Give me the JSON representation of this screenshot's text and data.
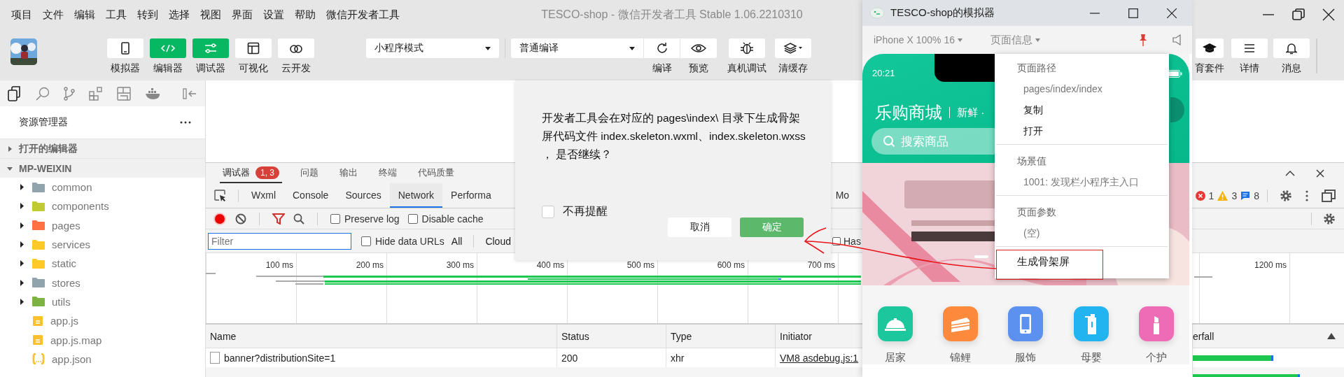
{
  "menu_bar": {
    "items": [
      "项目",
      "文件",
      "编辑",
      "工具",
      "转到",
      "选择",
      "视图",
      "界面",
      "设置",
      "帮助",
      "微信开发者工具"
    ]
  },
  "window": {
    "title": "TESCO-shop - 微信开发者工具 Stable 1.06.2210310"
  },
  "toolbar": {
    "view_buttons": [
      {
        "label": "模拟器",
        "on": false
      },
      {
        "label": "编辑器",
        "on": true
      },
      {
        "label": "调试器",
        "on": true
      },
      {
        "label": "可视化",
        "on": false
      },
      {
        "label": "云开发",
        "on": false
      }
    ],
    "mode_select": {
      "value": "小程序模式"
    },
    "compile_select": {
      "value": "普通编译"
    },
    "actions": [
      {
        "label": "编译"
      },
      {
        "label": "预览"
      },
      {
        "label": "真机调试"
      },
      {
        "label": "清缓存"
      }
    ],
    "right_buttons": [
      {
        "label": "育套件"
      },
      {
        "label": "详情"
      },
      {
        "label": "消息"
      }
    ]
  },
  "sidebar": {
    "title": "资源管理器",
    "sections": [
      {
        "label": "打开的编辑器",
        "expanded": false
      },
      {
        "label": "MP-WEIXIN",
        "expanded": true
      }
    ],
    "items": [
      {
        "name": "common",
        "kind": "folder",
        "color": "#90a4ae",
        "expanded": false
      },
      {
        "name": "components",
        "kind": "folder",
        "color": "#c0ca33",
        "expanded": false
      },
      {
        "name": "pages",
        "kind": "folder",
        "color": "#ff7043",
        "expanded": false
      },
      {
        "name": "services",
        "kind": "folder",
        "color": "#ffca28",
        "expanded": false
      },
      {
        "name": "static",
        "kind": "folder",
        "color": "#ffca28",
        "expanded": false
      },
      {
        "name": "stores",
        "kind": "folder",
        "color": "#90a4ae",
        "expanded": false
      },
      {
        "name": "utils",
        "kind": "folder",
        "color": "#7cb342",
        "expanded": false
      },
      {
        "name": "app.js",
        "kind": "js",
        "color": "#fbc02d"
      },
      {
        "name": "app.js.map",
        "kind": "js",
        "color": "#fbc02d"
      },
      {
        "name": "app.json",
        "kind": "json",
        "color": "#fbc02d"
      }
    ]
  },
  "debugger": {
    "tabs": [
      {
        "label": "调试器",
        "badge": "1, 3",
        "selected": true
      },
      {
        "label": "问题",
        "selected": false
      },
      {
        "label": "输出",
        "selected": false
      },
      {
        "label": "终端",
        "selected": false
      },
      {
        "label": "代码质量",
        "selected": false
      }
    ],
    "devtools_tabs": [
      {
        "label": "Wxml",
        "selected": false
      },
      {
        "label": "Console",
        "selected": false
      },
      {
        "label": "Sources",
        "selected": false
      },
      {
        "label": "Network",
        "selected": true
      },
      {
        "label": "Performa",
        "selected": false
      },
      {
        "label": "Mo",
        "selected": false
      }
    ],
    "counts": {
      "errors": "1",
      "warnings": "3",
      "messages": "8"
    },
    "network_toolbar": {
      "recording": true,
      "options": [
        {
          "label": "Preserve log",
          "checked": false
        },
        {
          "label": "Disable cache",
          "checked": false
        }
      ]
    },
    "filter": {
      "placeholder": "Filter",
      "hide_data_urls": {
        "label": "Hide data URLs",
        "checked": false
      },
      "types": [
        "All",
        "Cloud"
      ],
      "has": {
        "label": "Has",
        "checked": false
      }
    },
    "timeline": {
      "ticks": [
        "100 ms",
        "200 ms",
        "300 ms",
        "400 ms",
        "500 ms",
        "600 ms",
        "700 ms"
      ],
      "end_tick": "1200 ms"
    },
    "table": {
      "columns": [
        "Name",
        "Status",
        "Type",
        "Initiator",
        "erfall"
      ],
      "rows": [
        {
          "cells": [
            "banner?distributionSite=1",
            "200",
            "xhr",
            "VM8 asdebug.js:1"
          ]
        }
      ]
    }
  },
  "dialog": {
    "message": "开发者工具会在对应的 pages\\index\\ 目录下生成骨架屏代码文件 index.skeleton.wxml、index.skeleton.wxss ， 是否继续？",
    "dont_remind": {
      "label": "不再提醒",
      "checked": false
    },
    "buttons": [
      {
        "label": "取消",
        "kind": "secondary"
      },
      {
        "label": "确定",
        "kind": "primary"
      }
    ]
  },
  "simulator": {
    "title": "TESCO-shop的模拟器",
    "device": "iPhone X 100% 16",
    "page_info": "页面信息",
    "pinned": true,
    "phone": {
      "time": "20:21",
      "brand": "乐购商城",
      "slogan": "新鲜 ·",
      "search_placeholder": "搜索商品",
      "categories": [
        {
          "label": "居家",
          "color": "#1cc79d"
        },
        {
          "label": "锦鲤",
          "color": "#fd8a3c"
        },
        {
          "label": "服饰",
          "color": "#5d91ef"
        },
        {
          "label": "母婴",
          "color": "#22b4f0"
        },
        {
          "label": "个护",
          "color": "#ee6bb5"
        }
      ]
    },
    "menu": {
      "sections": [
        {
          "header": "页面路径",
          "items": [
            {
              "label": "pages/index/index",
              "kind": "value"
            },
            {
              "label": "复制",
              "kind": "action"
            },
            {
              "label": "打开",
              "kind": "action"
            }
          ]
        },
        {
          "header": "场景值",
          "items": [
            {
              "label": "1001: 发现栏小程序主入口",
              "kind": "value"
            }
          ]
        },
        {
          "header": "页面参数",
          "items": [
            {
              "label": "(空)",
              "kind": "value"
            }
          ]
        }
      ],
      "action": "生成骨架屏"
    }
  }
}
